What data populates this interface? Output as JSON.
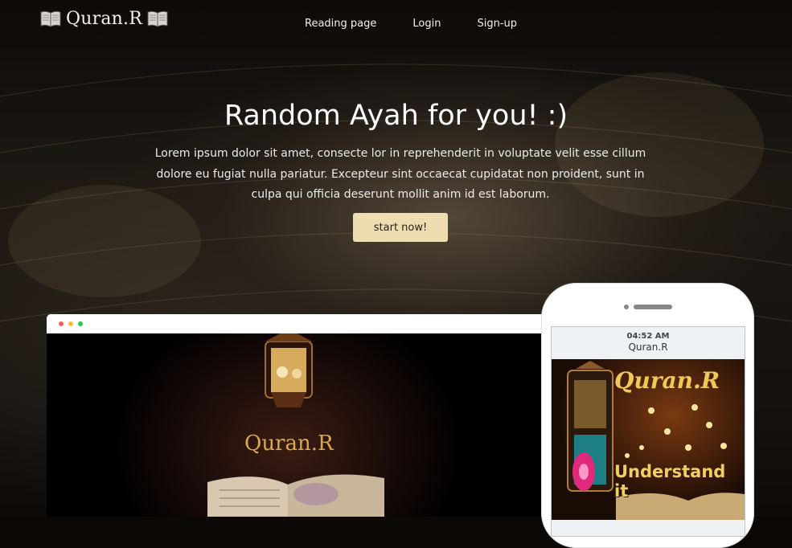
{
  "header": {
    "brand": "Quran.R",
    "nav": [
      "Reading page",
      "Login",
      "Sign-up"
    ]
  },
  "hero": {
    "title": "Random Ayah for you! :)",
    "lead": "Lorem ipsum dolor sit amet, consecte lor in reprehenderit in voluptate velit esse cillum dolore eu fugiat nulla pariatur. Excepteur sint occaecat cupidatat non proident, sunt in culpa qui officia deserunt mollit anim id est laborum.",
    "cta": "start now!"
  },
  "browser_mockup": {
    "window_dots": [
      "#ff5f57",
      "#febc2e",
      "#28c840"
    ],
    "screen_brand": "Quran.R"
  },
  "phone_mockup": {
    "time": "04:52 AM",
    "app_name": "Quran.R",
    "image_brand": "Quran.R",
    "image_tagline": "Understand it"
  },
  "colors": {
    "accent": "#efddb2",
    "gold": "#f0c95a"
  },
  "icons": {
    "logo": "open-book-icon"
  }
}
